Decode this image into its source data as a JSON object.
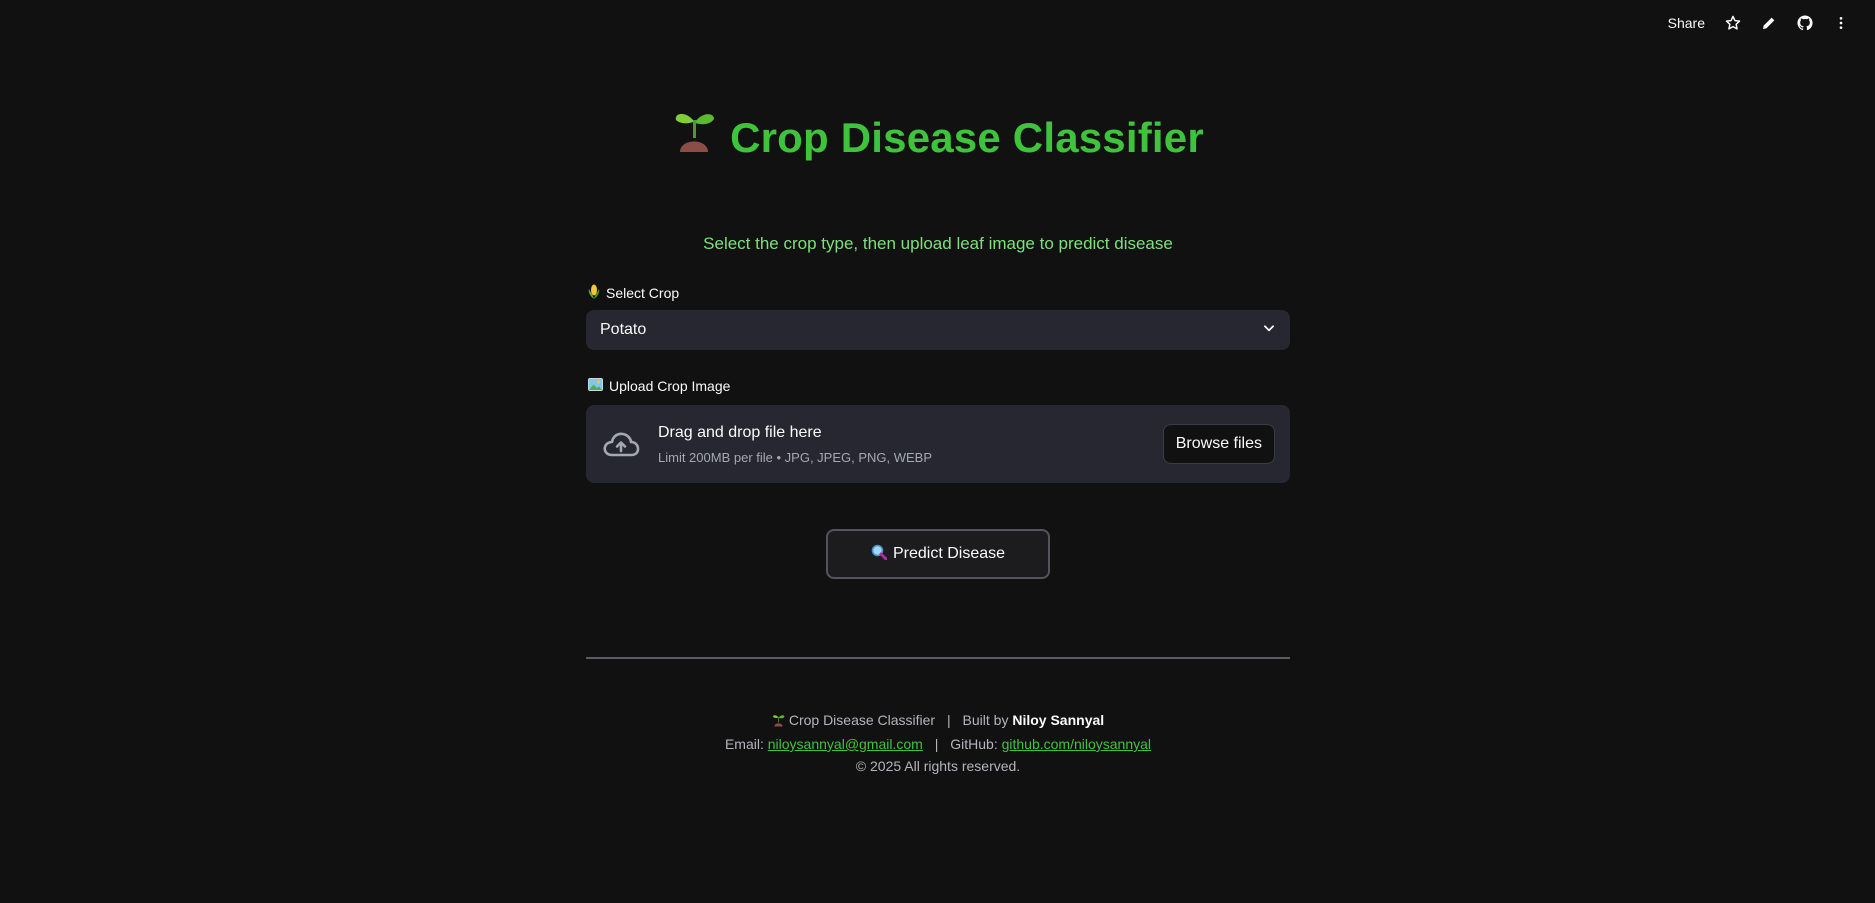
{
  "toolbar": {
    "share_label": "Share",
    "icons": [
      "star-icon",
      "pencil-icon",
      "github-icon",
      "more-vertical-icon"
    ]
  },
  "header": {
    "title": "Crop Disease Classifier",
    "title_color": "#3ec43b",
    "subtitle": "Select the crop type, then upload leaf image to predict disease"
  },
  "select_crop": {
    "label": "Select Crop",
    "value": "Potato"
  },
  "upload": {
    "label": "Upload Crop Image",
    "dropzone_title": "Drag and drop file here",
    "limit_text": "Limit 200MB per file • JPG, JPEG, PNG, WEBP",
    "browse_label": "Browse files"
  },
  "predict": {
    "label": "Predict Disease"
  },
  "footer": {
    "app_name": "Crop Disease Classifier",
    "built_by_prefix": "Built by",
    "author": "Niloy Sannyal",
    "email_label": "Email:",
    "email": "niloysannyal@gmail.com",
    "github_label": "GitHub:",
    "github": "github.com/niloysannyal",
    "copyright": "© 2025 All rights reserved.",
    "separator": "|"
  }
}
